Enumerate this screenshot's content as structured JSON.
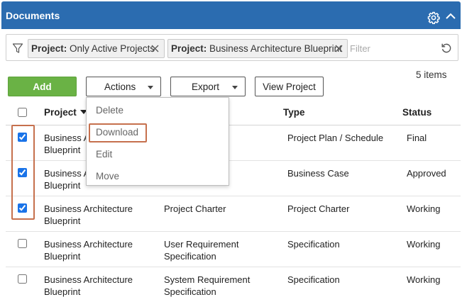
{
  "panel": {
    "title": "Documents"
  },
  "filters": {
    "chips": [
      {
        "key": "Project:",
        "value": "Only Active Projects"
      },
      {
        "key": "Project:",
        "value": "Business Architecture Blueprint"
      }
    ],
    "placeholder": "Filter"
  },
  "toolbar": {
    "add_label": "Add",
    "actions_label": "Actions",
    "export_label": "Export",
    "view_project_label": "View Project",
    "items_count": "5 items"
  },
  "actions_menu": {
    "items": [
      "Delete",
      "Download",
      "Edit",
      "Move"
    ],
    "highlighted": "Download"
  },
  "table": {
    "columns": {
      "project": "Project",
      "type": "Type",
      "status": "Status"
    },
    "rows": [
      {
        "checked": true,
        "project": [
          "Business A",
          "Blueprint"
        ],
        "name": [
          "",
          ""
        ],
        "type": "Project Plan / Schedule",
        "status": "Final"
      },
      {
        "checked": true,
        "project": [
          "Business A",
          "Blueprint"
        ],
        "name": [
          "",
          ""
        ],
        "type": "Business Case",
        "status": "Approved"
      },
      {
        "checked": true,
        "project": [
          "Business Architecture",
          "Blueprint"
        ],
        "name": [
          "Project Charter",
          ""
        ],
        "type": "Project Charter",
        "status": "Working"
      },
      {
        "checked": false,
        "project": [
          "Business Architecture",
          "Blueprint"
        ],
        "name": [
          "User Requirement",
          "Specification"
        ],
        "type": "Specification",
        "status": "Working"
      },
      {
        "checked": false,
        "project": [
          "Business Architecture",
          "Blueprint"
        ],
        "name": [
          "System Requirement",
          "Specification"
        ],
        "type": "Specification",
        "status": "Working"
      }
    ]
  },
  "colors": {
    "header": "#2b6cb0",
    "add_button": "#6ab245",
    "highlight": "#c6704d",
    "checkbox": "#1a73e8"
  },
  "icons": {
    "settings": "gear-icon",
    "collapse": "chevron-up-icon",
    "filter": "funnel-icon",
    "remove": "close-icon",
    "reset": "reset-icon"
  }
}
